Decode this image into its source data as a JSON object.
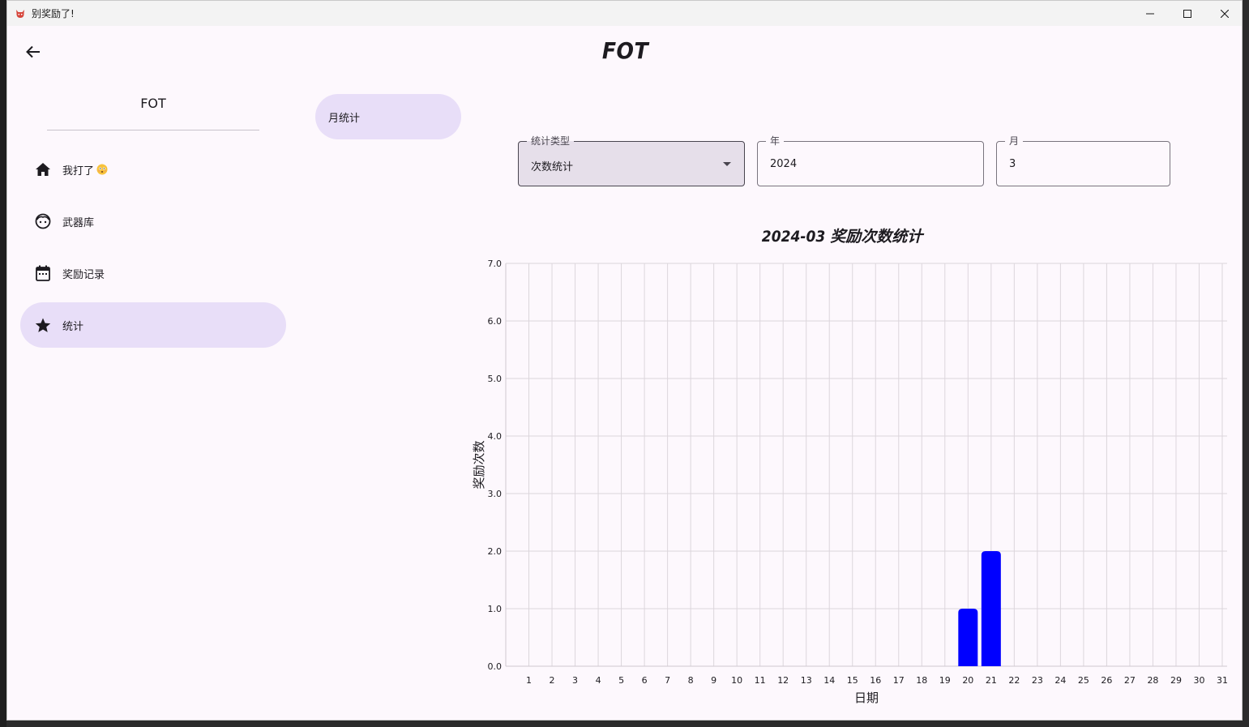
{
  "window": {
    "title": "别奖励了!"
  },
  "appbar": {
    "title": "FOT"
  },
  "drawer": {
    "header": "FOT",
    "items": [
      {
        "label": "我打了",
        "icon": "home-icon",
        "active": false
      },
      {
        "label": "武器库",
        "icon": "face-icon",
        "active": false
      },
      {
        "label": "奖励记录",
        "icon": "calendar-icon",
        "active": false
      },
      {
        "label": "统计",
        "icon": "star-icon",
        "active": true
      }
    ]
  },
  "tabs": [
    {
      "label": "月统计",
      "active": true
    }
  ],
  "filters": {
    "stat_type": {
      "label": "统计类型",
      "value": "次数统计"
    },
    "year": {
      "label": "年",
      "value": "2024"
    },
    "month": {
      "label": "月",
      "value": "3"
    }
  },
  "colors": {
    "bar": "#0000ff",
    "active_bg": "#e8def8",
    "grid": "#dcd6dc"
  },
  "chart_data": {
    "type": "bar",
    "title": "2024-03 奖励次数统计",
    "xlabel": "日期",
    "ylabel": "奖励次数",
    "ylim": [
      0,
      7
    ],
    "yticks": [
      "0.0",
      "1.0",
      "2.0",
      "3.0",
      "4.0",
      "5.0",
      "6.0",
      "7.0"
    ],
    "categories": [
      "1",
      "2",
      "3",
      "4",
      "5",
      "6",
      "7",
      "8",
      "9",
      "10",
      "11",
      "12",
      "13",
      "14",
      "15",
      "16",
      "17",
      "18",
      "19",
      "20",
      "21",
      "22",
      "23",
      "24",
      "25",
      "26",
      "27",
      "28",
      "29",
      "30",
      "31"
    ],
    "values": [
      0,
      0,
      0,
      0,
      0,
      0,
      0,
      0,
      0,
      0,
      0,
      0,
      0,
      0,
      0,
      0,
      0,
      0,
      0,
      1,
      2,
      0,
      0,
      0,
      0,
      0,
      0,
      0,
      0,
      0,
      0
    ],
    "grid": true,
    "legend": "none"
  }
}
